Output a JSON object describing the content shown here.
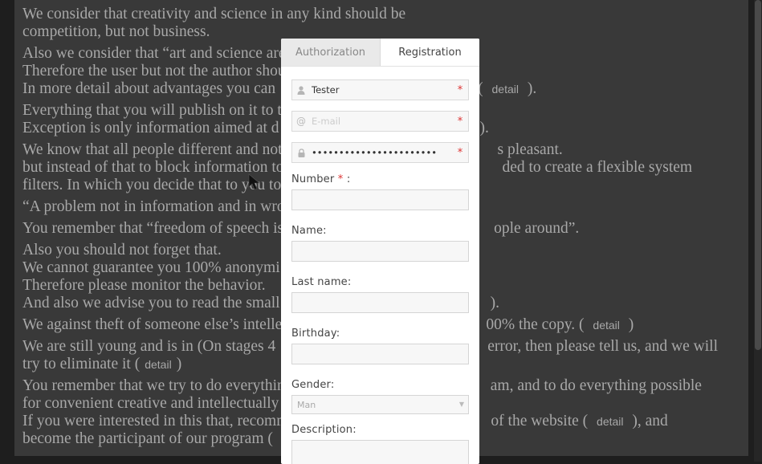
{
  "background": {
    "paragraphs": [
      {
        "lines": [
          "We consider that creativity and science in any kind should be",
          "competition, but not business."
        ]
      },
      {
        "lines": [
          "Also we consider that “art and science are",
          "Therefore the user but not the author shou",
          "In more detail about advantages you can"
        ],
        "detail": "detail",
        "tail": ")."
      },
      {
        "lines": [
          "Everything that you will publish on it to t",
          "Exception is only information aimed at d"
        ],
        "tail": ")."
      },
      {
        "lines": [
          "We know that all people different and not",
          "but instead of that to block information to",
          "filters. In which you decide that to you to"
        ],
        "line_tails": [
          "s pleasant.",
          "ded to create a flexible system",
          ""
        ]
      },
      {
        "lines": [
          "“A problem not in information and in wro"
        ]
      },
      {
        "lines": [
          "You remember that “freedom of speech is"
        ],
        "line_tails": [
          "ople around”."
        ]
      },
      {
        "lines": [
          "Also you should not forget that.",
          "We cannot guarantee you 100% anonymi",
          "Therefore please monitor the behavior.",
          "And also we advise you to read the small"
        ],
        "line_tails": [
          "",
          "",
          "",
          ")."
        ]
      },
      {
        "lines": [
          "We against theft of someone else’s intelle"
        ],
        "line_tails": [
          "00% the copy. ("
        ],
        "detail": "detail",
        "tail": ")"
      },
      {
        "lines": [
          "We are still young and is in (On stages 4",
          "try to eliminate it ("
        ],
        "line_tails": [
          "error, then please tell us, and we will",
          ""
        ],
        "detail": "detail",
        "tail": ")"
      },
      {
        "lines": [
          "You remember that we try to do everythin",
          "for convenient creative and intellectually",
          "If you were interested in this that, recomm",
          "become the participant of our program ("
        ],
        "line_tails": [
          "am, and to do everything possible",
          "",
          "of the website (",
          ""
        ],
        "detail": "detail",
        "tail": "), and"
      }
    ]
  },
  "modal": {
    "tabs": [
      {
        "label": "Authorization",
        "active": false
      },
      {
        "label": "Registration",
        "active": true
      }
    ],
    "login_field": {
      "value": "Tester",
      "placeholder": "",
      "required": "*"
    },
    "email_field": {
      "value": "",
      "placeholder": "E-mail",
      "required": "*"
    },
    "password_field": {
      "value": "xxxxxxxxxxxxxxxxxxxxxxx",
      "required": "*"
    },
    "number": {
      "label": "Number",
      "required": "*",
      "suffix": ":"
    },
    "name": {
      "label": "Name:"
    },
    "last_name": {
      "label": "Last name:"
    },
    "birthday": {
      "label": "Birthday:"
    },
    "gender": {
      "label": "Gender:",
      "selected": "Man"
    },
    "description": {
      "label": "Description:"
    }
  },
  "colors": {
    "required": "#dd3333",
    "overlay": "#393939",
    "modal_bg": "#ffffff"
  },
  "icons": {
    "login": "user-icon",
    "email": "at-icon",
    "password": "lock-icon",
    "select": "chevron-down-icon"
  }
}
